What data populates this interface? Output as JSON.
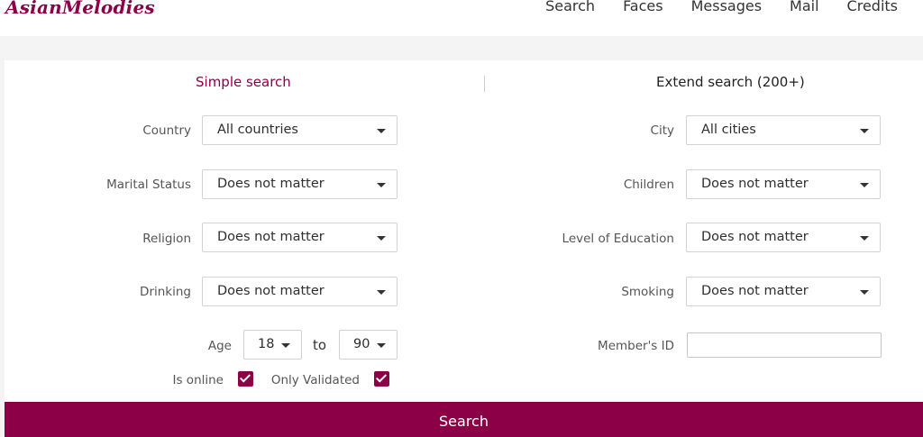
{
  "header": {
    "logo": "AsianMelodies",
    "nav": [
      "Search",
      "Faces",
      "Messages",
      "Mail",
      "Credits"
    ]
  },
  "tabs": {
    "simple": "Simple search",
    "extend": "Extend search (200+)"
  },
  "fields": {
    "country": {
      "label": "Country",
      "value": "All countries"
    },
    "marital_status": {
      "label": "Marital Status",
      "value": "Does not matter"
    },
    "religion": {
      "label": "Religion",
      "value": "Does not matter"
    },
    "drinking": {
      "label": "Drinking",
      "value": "Does not matter"
    },
    "city": {
      "label": "City",
      "value": "All cities"
    },
    "children": {
      "label": "Children",
      "value": "Does not matter"
    },
    "education": {
      "label": "Level of Education",
      "value": "Does not matter"
    },
    "smoking": {
      "label": "Smoking",
      "value": "Does not matter"
    },
    "age": {
      "label": "Age",
      "from": "18",
      "to_label": "to",
      "to": "90"
    },
    "member_id": {
      "label": "Member's ID",
      "value": ""
    }
  },
  "checkboxes": {
    "is_online": {
      "label": "Is online",
      "checked": true
    },
    "only_validated": {
      "label": "Only Validated",
      "checked": true
    }
  },
  "search_button": "Search",
  "colors": {
    "accent": "#8b0046"
  }
}
